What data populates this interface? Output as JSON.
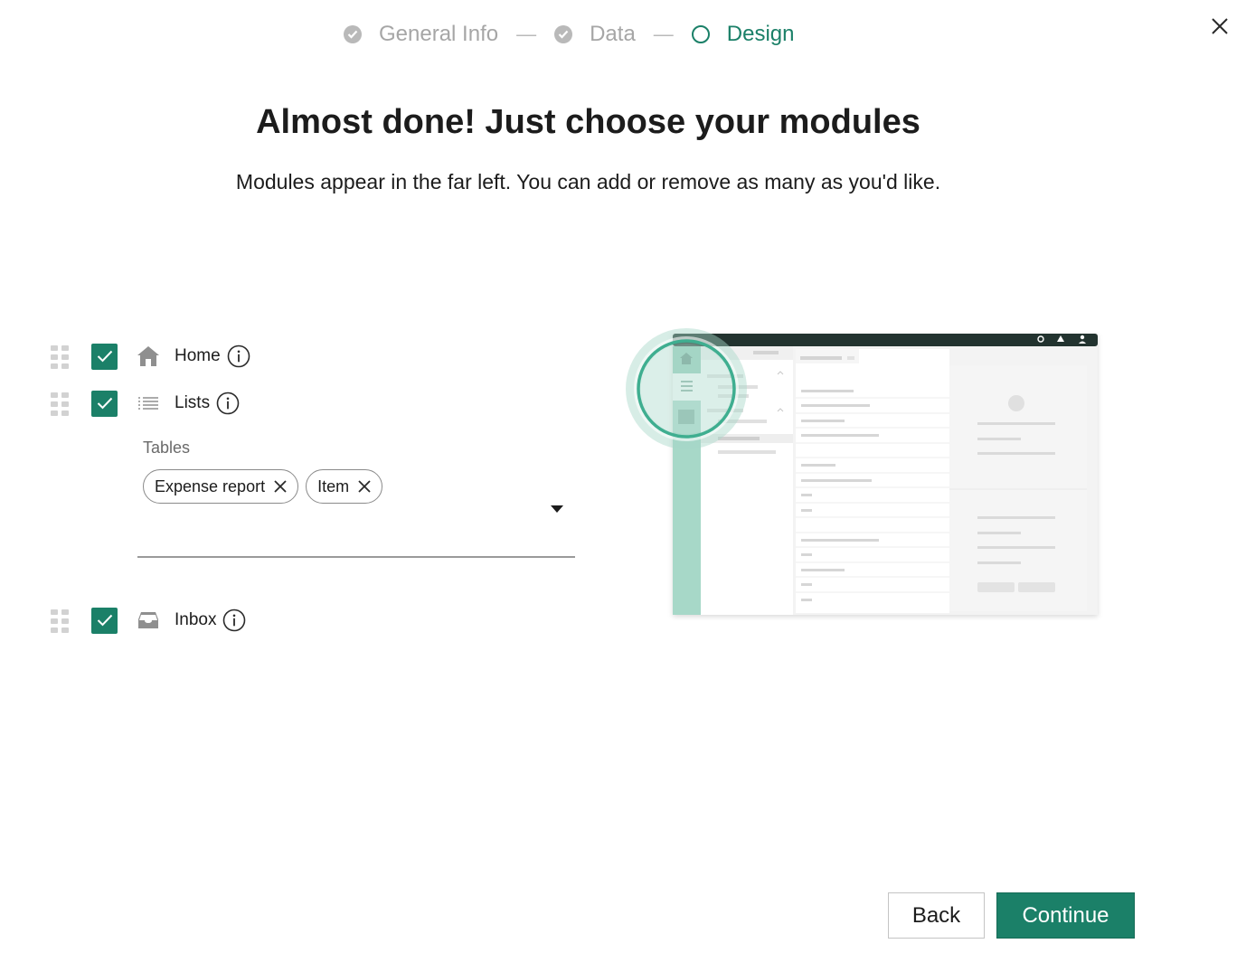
{
  "stepper": {
    "steps": [
      {
        "label": "General Info",
        "state": "done"
      },
      {
        "label": "Data",
        "state": "done"
      },
      {
        "label": "Design",
        "state": "current"
      }
    ],
    "separator": "—"
  },
  "header": {
    "title": "Almost done! Just choose your modules",
    "subtitle": "Modules appear in the far left. You can add or remove as many as you'd like."
  },
  "modules": [
    {
      "label": "Home",
      "icon": "home-icon",
      "checked": true
    },
    {
      "label": "Lists",
      "icon": "list-icon",
      "checked": true
    },
    {
      "label": "Inbox",
      "icon": "inbox-icon",
      "checked": true
    }
  ],
  "tables": {
    "label": "Tables",
    "chips": [
      "Expense report",
      "Item"
    ]
  },
  "footer": {
    "back_label": "Back",
    "continue_label": "Continue"
  },
  "colors": {
    "accent": "#1b8068",
    "done_step": "#b9b9b9",
    "illustration_mint": "#a7d8c8",
    "illustration_header": "#22332f"
  }
}
